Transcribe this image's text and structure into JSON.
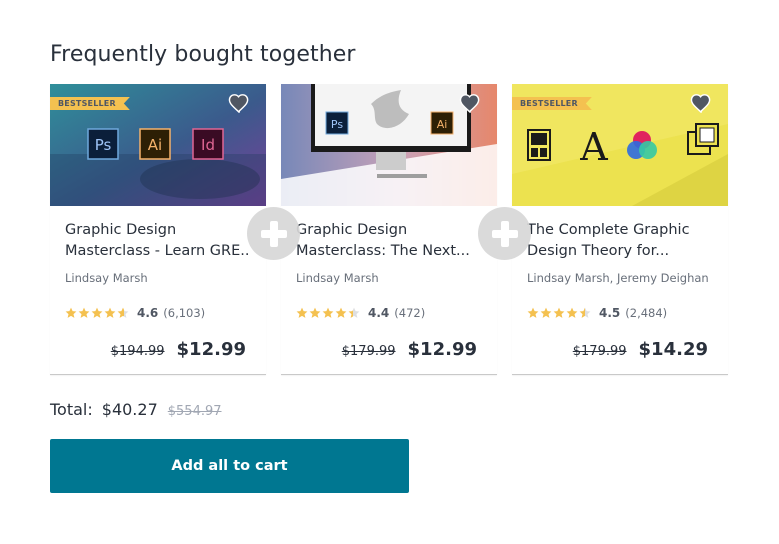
{
  "section": {
    "title": "Frequently bought together"
  },
  "courses": [
    {
      "badge": "BESTSELLER",
      "title_line1": "Graphic Design",
      "title_line2": "Masterclass - Learn GRE...",
      "author": "Lindsay Marsh",
      "rating": "4.6",
      "rating_stars": 4.6,
      "review_count": "(6,103)",
      "original_price": "$194.99",
      "price": "$12.99",
      "thumbnail_icons": [
        "Ps",
        "Ai",
        "Id"
      ]
    },
    {
      "badge": "",
      "title_line1": "Graphic Design",
      "title_line2": "Masterclass: The Next...",
      "author": "Lindsay Marsh",
      "rating": "4.4",
      "rating_stars": 4.4,
      "review_count": "(472)",
      "original_price": "$179.99",
      "price": "$12.99",
      "thumbnail_icons": [
        "Ps",
        "Ai"
      ]
    },
    {
      "badge": "BESTSELLER",
      "title_line1": "The Complete Graphic",
      "title_line2": "Design Theory for...",
      "author": "Lindsay Marsh, Jeremy Deighan",
      "rating": "4.5",
      "rating_stars": 4.5,
      "review_count": "(2,484)",
      "original_price": "$179.99",
      "price": "$14.29",
      "thumbnail_icons": [
        "A"
      ]
    }
  ],
  "total": {
    "label": "Total:",
    "price": "$40.27",
    "original_price": "$554.97"
  },
  "cart_button": {
    "label": "Add all to cart"
  },
  "colors": {
    "accent": "#007791",
    "badge": "#f4c150",
    "star": "#f4c150",
    "text": "#29303b"
  },
  "icons": {
    "wishlist": "heart-icon",
    "separator": "plus-icon",
    "rating": "star-icon"
  }
}
